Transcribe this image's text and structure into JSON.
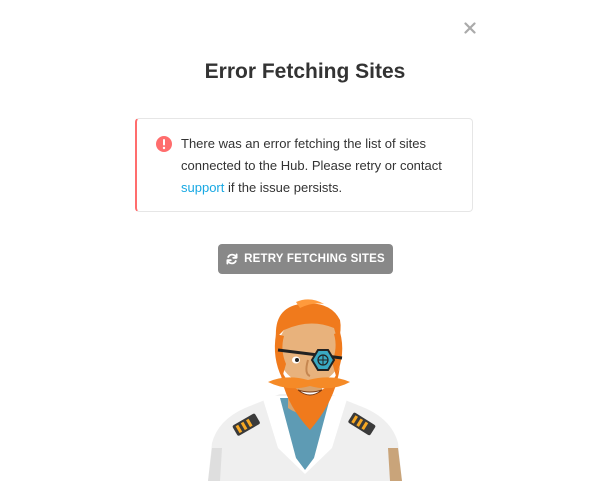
{
  "dialog": {
    "title": "Error Fetching Sites",
    "close_icon": "close-icon"
  },
  "alert": {
    "icon": "error-icon",
    "accent_color": "#ff6d6d",
    "text_before_link": "There was an error fetching the list of sites connected to the Hub. Please retry or contact ",
    "link_label": "support",
    "text_after_link": " if the issue persists."
  },
  "retry_button": {
    "label": "RETRY FETCHING SITES",
    "icon": "refresh-icon",
    "background": "#888888"
  },
  "illustration": {
    "name": "pirate-captain-mascot"
  }
}
